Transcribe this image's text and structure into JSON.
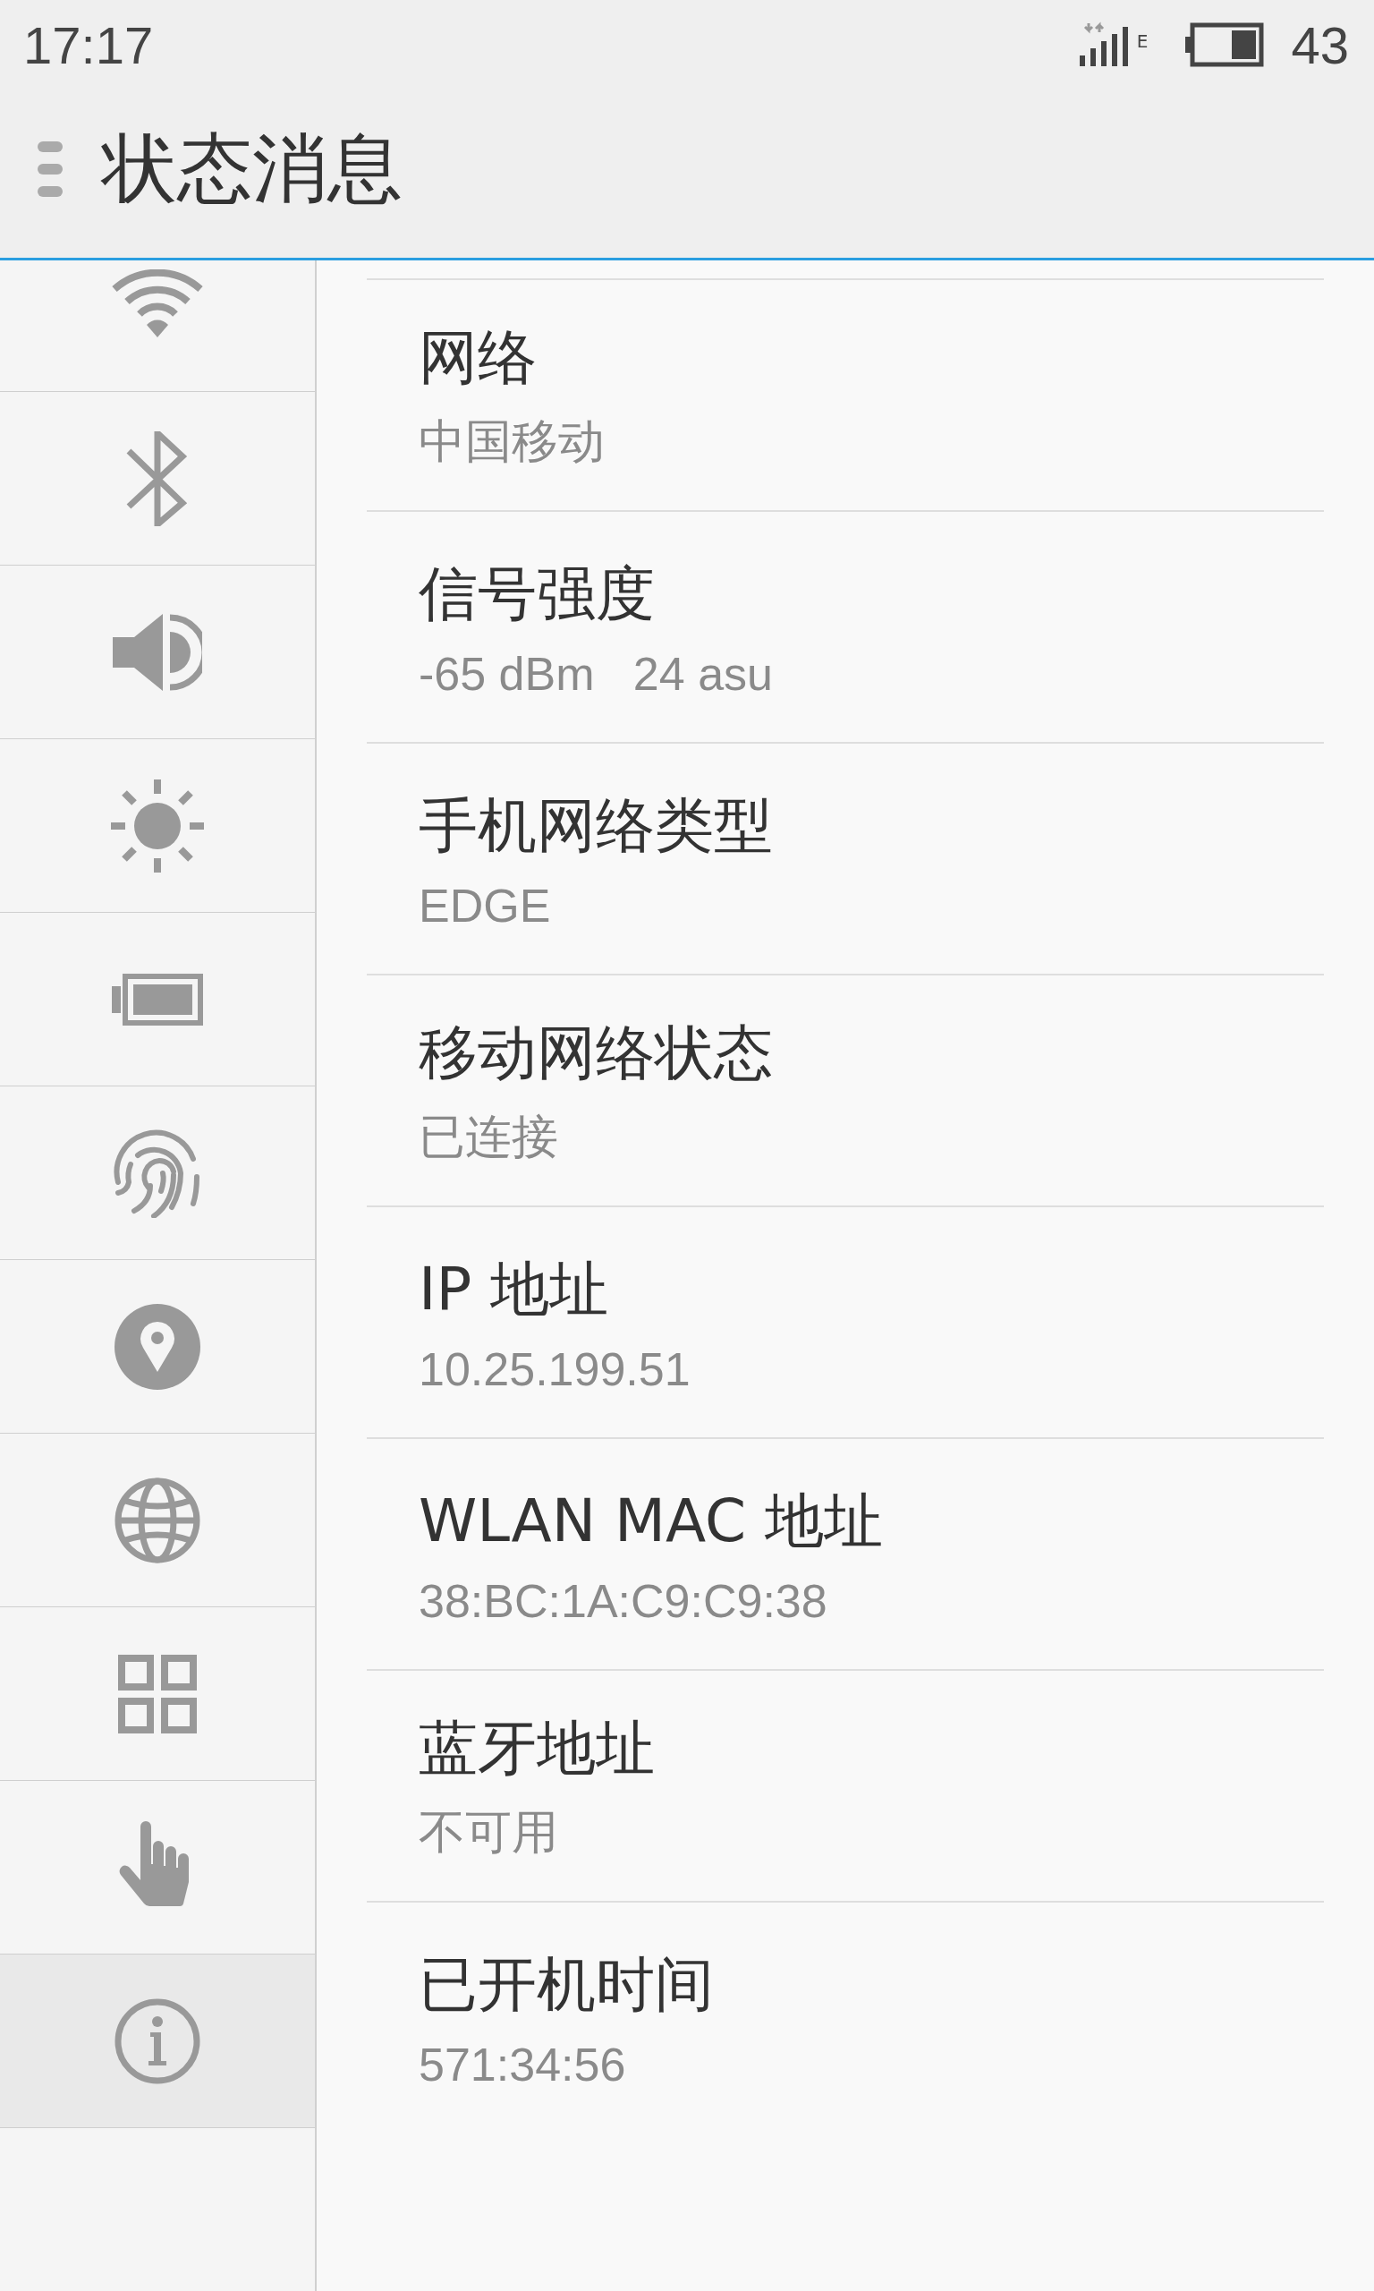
{
  "status_bar": {
    "time": "17:17",
    "network_type": "E",
    "battery": "43"
  },
  "header": {
    "title": "状态消息"
  },
  "sidebar": {
    "items": [
      {
        "kind": "wifi",
        "selected": false
      },
      {
        "kind": "bluetooth",
        "selected": false
      },
      {
        "kind": "sound",
        "selected": false
      },
      {
        "kind": "brightness",
        "selected": false
      },
      {
        "kind": "battery",
        "selected": false
      },
      {
        "kind": "fingerprint",
        "selected": false
      },
      {
        "kind": "location",
        "selected": false
      },
      {
        "kind": "globe",
        "selected": false
      },
      {
        "kind": "apps",
        "selected": false
      },
      {
        "kind": "hand",
        "selected": false
      },
      {
        "kind": "info",
        "selected": true
      }
    ]
  },
  "details": [
    {
      "title": "网络",
      "value": "中国移动"
    },
    {
      "title": "信号强度",
      "value": "-65 dBm   24 asu"
    },
    {
      "title": "手机网络类型",
      "value": "EDGE"
    },
    {
      "title": "移动网络状态",
      "value": "已连接"
    },
    {
      "title": "IP 地址",
      "value": "10.25.199.51"
    },
    {
      "title": "WLAN MAC 地址",
      "value": "38:BC:1A:C9:C9:38"
    },
    {
      "title": "蓝牙地址",
      "value": "不可用"
    },
    {
      "title": "已开机时间",
      "value": "571:34:56"
    }
  ]
}
